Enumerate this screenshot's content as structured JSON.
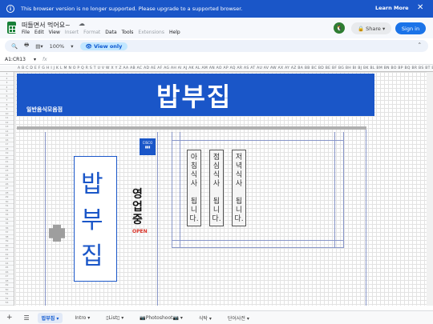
{
  "banner": {
    "message": "This browser version is no longer supported. Please upgrade to a supported browser.",
    "learn_more": "Learn More",
    "close": "✕"
  },
  "doc": {
    "title": "떠들면서 먹어요~",
    "cloud_icon": "cloud-icon"
  },
  "menu": {
    "items": [
      "File",
      "Edit",
      "View",
      "Insert",
      "Format",
      "Data",
      "Tools",
      "Extensions",
      "Help"
    ]
  },
  "header": {
    "avatar": "🐧",
    "share_label": "Share",
    "signin_label": "Sign in"
  },
  "toolbar": {
    "zoom": "100%",
    "view_only_label": "View only"
  },
  "formula_bar": {
    "cell_ref": "A1:CR13",
    "fx": "fx"
  },
  "columns": "A B C D E F G H I J K L M N O P Q R S T U V W X Y Z AA AB AC AD AE AF AG AH AI AJ AK AL AM AN AO AP AQ AR AS AT AU AV AW AX AY AZ BA BB BC BD BE BF BG BH BI BJ BK BL BM BN BO BP BQ BR BS BT BU BV BW BX BY BZ CA CB CC CD CE CF CG CH CI CJ CK CL CM CN CO CP CQ CR",
  "sheet": {
    "title": "밥부집",
    "subtitle": "일반음식모음점",
    "sign_chars": [
      "밥",
      "부",
      "집"
    ],
    "open_chars": [
      "영",
      "업",
      "중"
    ],
    "open_label": "OPEN",
    "cisco_label": "CISCO",
    "notices": [
      [
        "아",
        "침",
        "식",
        "사",
        "",
        "됩",
        "니",
        "다."
      ],
      [
        "점",
        "심",
        "식",
        "사",
        "",
        "됩",
        "니",
        "다."
      ],
      [
        "저",
        "녁",
        "식",
        "사",
        "",
        "됩",
        "니",
        "다."
      ]
    ]
  },
  "sheet_tabs": [
    {
      "label": "밥부집",
      "active": true
    },
    {
      "label": "Intro",
      "active": false
    },
    {
      "label": "▯List▯",
      "active": false
    },
    {
      "label": "📷Photoshoot📷",
      "active": false
    },
    {
      "label": "식탁",
      "active": false
    },
    {
      "label": "단어사전",
      "active": false
    }
  ]
}
